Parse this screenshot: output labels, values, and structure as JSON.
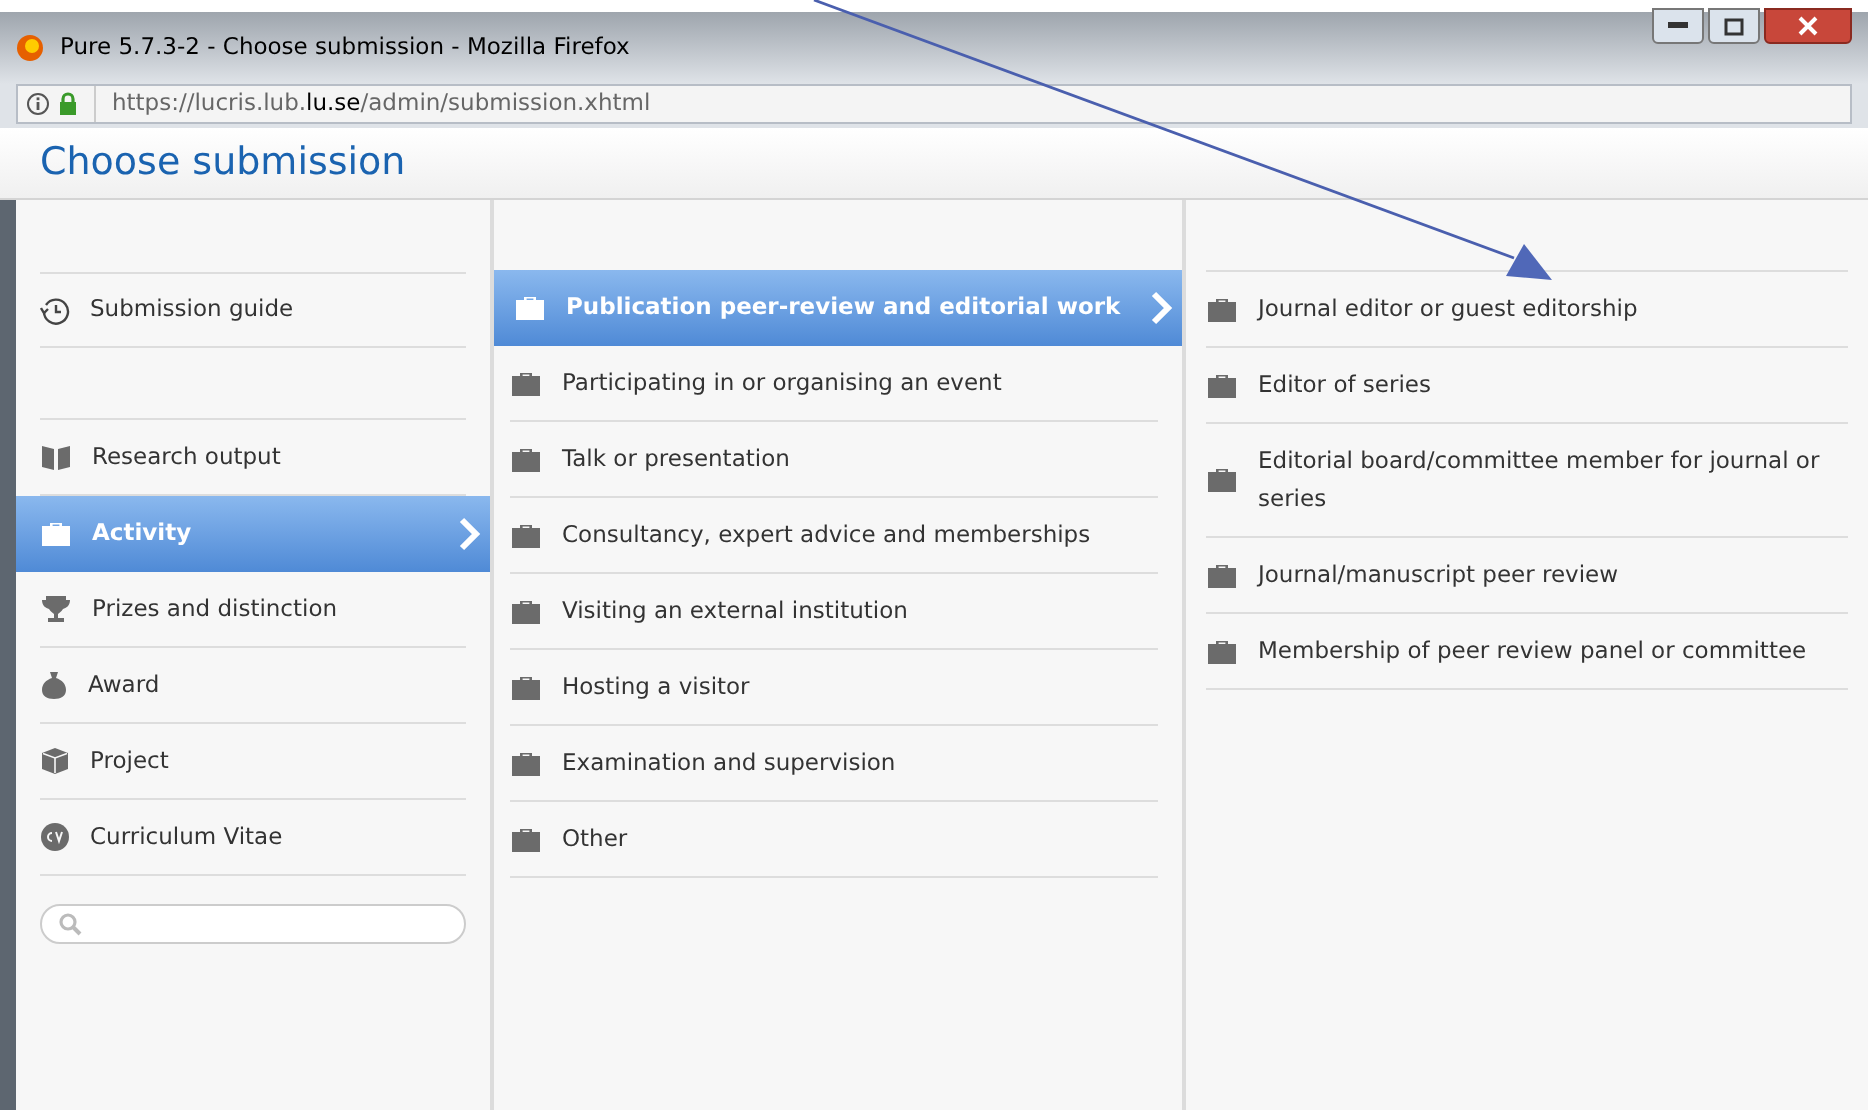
{
  "window": {
    "title": "Pure 5.7.3-2 - Choose submission - Mozilla Firefox",
    "url_prefix": "https://lucris.lub.",
    "url_domain": "lu.se",
    "url_suffix": "/admin/submission.xhtml"
  },
  "header": {
    "title": "Choose submission"
  },
  "guide": {
    "label": "Submission guide"
  },
  "categories": [
    {
      "label": "Research output",
      "selected": false
    },
    {
      "label": "Activity",
      "selected": true
    },
    {
      "label": "Prizes and distinction",
      "selected": false
    },
    {
      "label": "Award",
      "selected": false
    },
    {
      "label": "Project",
      "selected": false
    },
    {
      "label": "Curriculum Vitae",
      "selected": false
    }
  ],
  "types": [
    {
      "label": "Publication peer-review and editorial work",
      "selected": true
    },
    {
      "label": "Participating in or organising an event",
      "selected": false
    },
    {
      "label": "Talk or presentation",
      "selected": false
    },
    {
      "label": "Consultancy, expert advice and memberships",
      "selected": false
    },
    {
      "label": "Visiting an external institution",
      "selected": false
    },
    {
      "label": "Hosting a visitor",
      "selected": false
    },
    {
      "label": "Examination and supervision",
      "selected": false
    },
    {
      "label": "Other",
      "selected": false
    }
  ],
  "subtypes": [
    {
      "label": "Journal editor or guest editorship"
    },
    {
      "label": "Editor of series"
    },
    {
      "label": "Editorial board/committee member for journal or series"
    },
    {
      "label": "Journal/manuscript peer review"
    },
    {
      "label": "Membership of peer review panel or committee"
    }
  ]
}
